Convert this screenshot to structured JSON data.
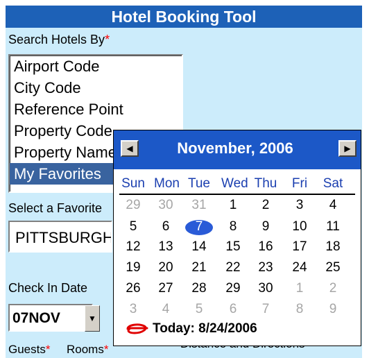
{
  "title": "Hotel Booking Tool",
  "search_by": {
    "label": "Search Hotels By",
    "required_mark": "*",
    "options": [
      "Airport Code",
      "City Code",
      "Reference Point",
      "Property Code",
      "Property Name",
      "My Favorites"
    ],
    "selected": "My Favorites"
  },
  "favorite": {
    "label": "Select a Favorite",
    "value": "PITTSBURGH"
  },
  "check_in": {
    "label": "Check In Date",
    "value": "07NOV"
  },
  "bottom": {
    "guests_label": "Guests",
    "guests_req": "*",
    "rooms_label": "Rooms",
    "rooms_req": "*",
    "distance_label": "Distance and Directions"
  },
  "calendar": {
    "month_label": "November, 2006",
    "weekdays": [
      "Sun",
      "Mon",
      "Tue",
      "Wed",
      "Thu",
      "Fri",
      "Sat"
    ],
    "weeks": [
      [
        {
          "d": "29",
          "m": 1
        },
        {
          "d": "30",
          "m": 1
        },
        {
          "d": "31",
          "m": 1
        },
        {
          "d": "1",
          "m": 0
        },
        {
          "d": "2",
          "m": 0
        },
        {
          "d": "3",
          "m": 0
        },
        {
          "d": "4",
          "m": 0
        }
      ],
      [
        {
          "d": "5",
          "m": 0
        },
        {
          "d": "6",
          "m": 0
        },
        {
          "d": "7",
          "m": 0,
          "s": 1
        },
        {
          "d": "8",
          "m": 0
        },
        {
          "d": "9",
          "m": 0
        },
        {
          "d": "10",
          "m": 0
        },
        {
          "d": "11",
          "m": 0
        }
      ],
      [
        {
          "d": "12",
          "m": 0
        },
        {
          "d": "13",
          "m": 0
        },
        {
          "d": "14",
          "m": 0
        },
        {
          "d": "15",
          "m": 0
        },
        {
          "d": "16",
          "m": 0
        },
        {
          "d": "17",
          "m": 0
        },
        {
          "d": "18",
          "m": 0
        }
      ],
      [
        {
          "d": "19",
          "m": 0
        },
        {
          "d": "20",
          "m": 0
        },
        {
          "d": "21",
          "m": 0
        },
        {
          "d": "22",
          "m": 0
        },
        {
          "d": "23",
          "m": 0
        },
        {
          "d": "24",
          "m": 0
        },
        {
          "d": "25",
          "m": 0
        }
      ],
      [
        {
          "d": "26",
          "m": 0
        },
        {
          "d": "27",
          "m": 0
        },
        {
          "d": "28",
          "m": 0
        },
        {
          "d": "29",
          "m": 0
        },
        {
          "d": "30",
          "m": 0
        },
        {
          "d": "1",
          "m": 1
        },
        {
          "d": "2",
          "m": 1
        }
      ],
      [
        {
          "d": "3",
          "m": 1
        },
        {
          "d": "4",
          "m": 1
        },
        {
          "d": "5",
          "m": 1
        },
        {
          "d": "6",
          "m": 1
        },
        {
          "d": "7",
          "m": 1
        },
        {
          "d": "8",
          "m": 1
        },
        {
          "d": "9",
          "m": 1
        }
      ]
    ],
    "today_label": "Today: 8/24/2006"
  },
  "colors": {
    "panel_bg": "#ccecfb",
    "title_bg": "#1d61b7",
    "calendar_header": "#1c58c7",
    "selected_day": "#2a5bd7",
    "weekday_text": "#1b3fb0",
    "required": "#ff0000"
  },
  "icons": {
    "prev": "left-triangle",
    "next": "right-triangle",
    "today": "red-scribble-circle"
  }
}
